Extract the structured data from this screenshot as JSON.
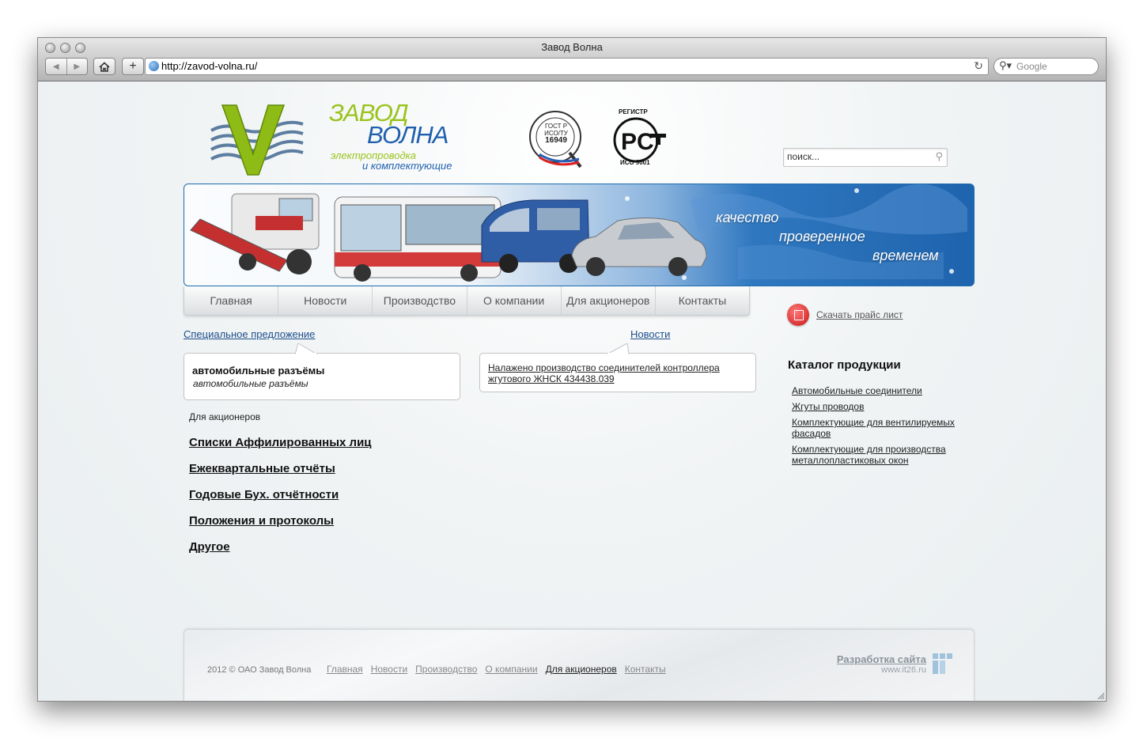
{
  "browser": {
    "window_title": "Завод Волна",
    "url": "http://zavod-volna.ru/",
    "search_placeholder": "Google"
  },
  "header": {
    "brand_line1": "ЗАВОД",
    "brand_line2": "ВОЛНА",
    "tagline_line1": "электропроводка",
    "tagline_line2": "и комплектующие",
    "cert_gost": [
      "ГОСТ Р",
      "ИСО/ТУ",
      "16949"
    ],
    "cert_registr_top": "РЕГИСТР",
    "cert_registr_bottom": "ИСО 9001",
    "search_placeholder": "поиск..."
  },
  "banner": {
    "slogan": [
      "качество",
      "проверенное",
      "временем"
    ]
  },
  "menu": [
    "Главная",
    "Новости",
    "Производство",
    "О компании",
    "Для акционеров",
    "Контакты"
  ],
  "special": {
    "link": "Специальное предложение",
    "title": "автомобильные разъёмы",
    "subtitle": "автомобильные разъёмы"
  },
  "news": {
    "link": "Новости",
    "item": "Налажено производство соединителей контроллера жгутового ЖНСК 434438.039"
  },
  "shareholders": {
    "title": "Для акционеров",
    "links": [
      "Списки Аффилированных лиц",
      "Ежеквартальные отчёты",
      "Годовые Бух. отчётности",
      "Положения и протоколы",
      "Другое"
    ]
  },
  "sidebar": {
    "price_link": "Скачать прайс лист",
    "catalog_title": "Каталог продукции",
    "catalog": [
      [
        "Автомобильные соединители"
      ],
      [
        "Жгуты проводов"
      ],
      [
        "Комплектующие для вентилируемых",
        "фасадов"
      ],
      [
        "Комплектующие для производства",
        "металлопластиковых окон"
      ]
    ]
  },
  "footer": {
    "copyright": "2012 © ОАО Завод Волна",
    "links": [
      "Главная",
      "Новости",
      "Производство",
      "О компании",
      "Для акционеров",
      "Контакты"
    ],
    "active_link": "Для акционеров",
    "dev_title": "Разработка сайта",
    "dev_url": "www.it26.ru"
  },
  "colors": {
    "brand_green": "#9ac31c",
    "brand_blue": "#1f5fae",
    "banner_blue": "#1e63ad",
    "link_blue": "#1e4f8c",
    "accent_red": "#c91515"
  }
}
